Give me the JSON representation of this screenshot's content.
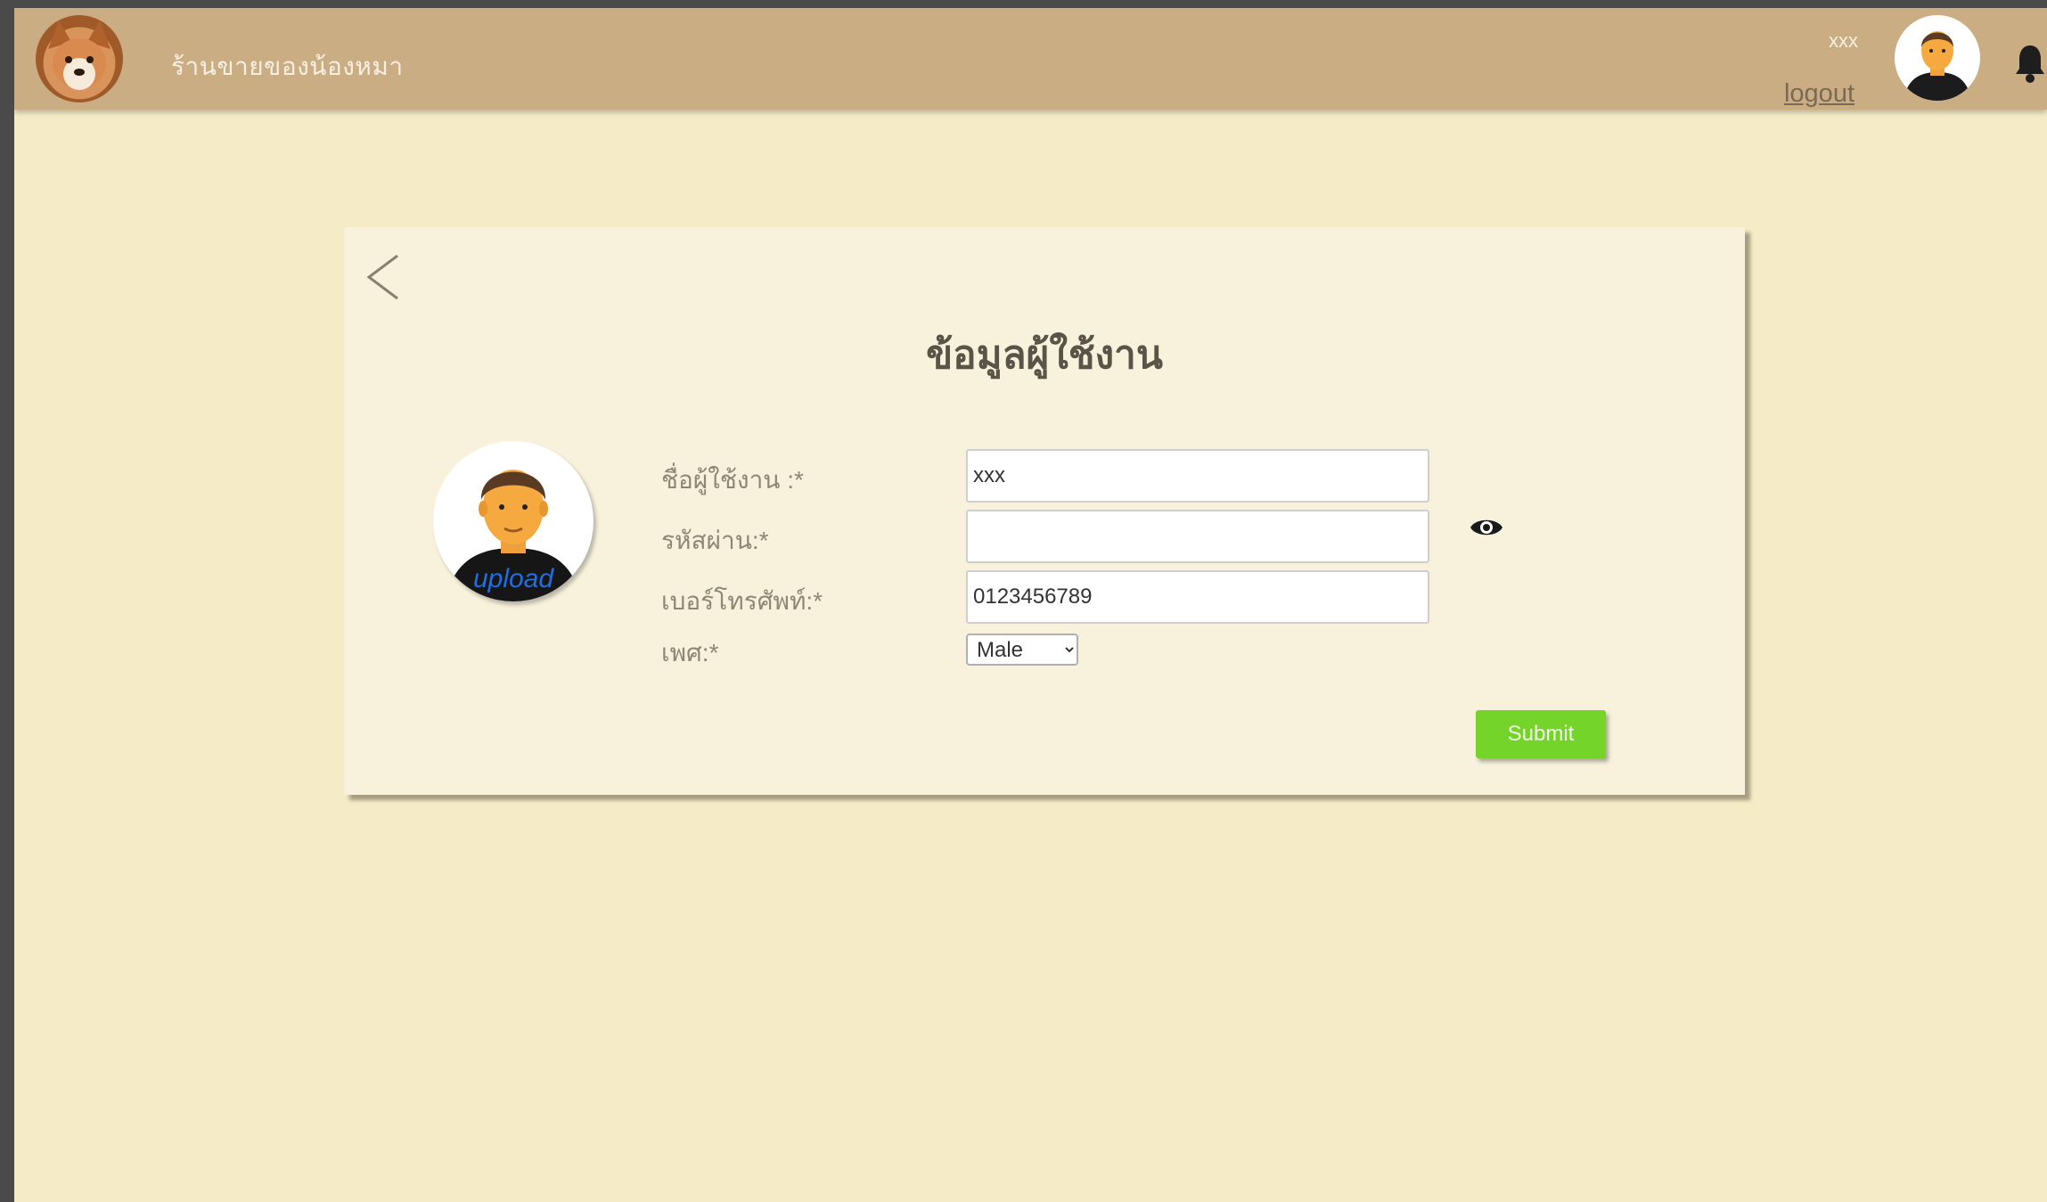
{
  "header": {
    "shop_name": "ร้านขายของน้องหมา",
    "user_name": "xxx",
    "logout_label": "logout"
  },
  "profile_form": {
    "title": "ข้อมูลผู้ใช้งาน",
    "avatar_upload_label": "upload",
    "username_label": "ชื่อผู้ใช้งาน :*",
    "username_value": "xxx",
    "password_label": "รหัสผ่าน:*",
    "password_value": "",
    "phone_label": "เบอร์โทรศัพท์:*",
    "phone_value": "0123456789",
    "gender_label": "เพศ:*",
    "gender_selected": "Male",
    "submit_label": "Submit"
  },
  "colors": {
    "header_bg": "#cbad84",
    "page_bg": "#f5ebc6",
    "card_bg": "#f8f1dc",
    "submit_bg": "#74d42a",
    "upload_text": "#1f6fe0"
  },
  "icons": {
    "logo": "dog-logo-icon",
    "avatar": "user-avatar-icon",
    "notifications": "bell-icon",
    "back": "chevron-left-icon",
    "toggle_password": "eye-icon"
  }
}
